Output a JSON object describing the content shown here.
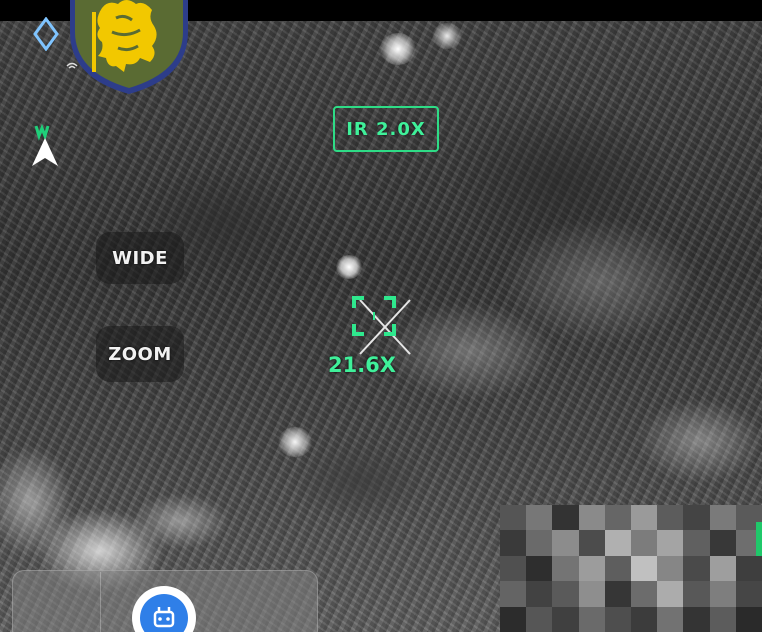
{
  "hud": {
    "camera_mode_label": "IR 2.0X",
    "wide_label": "WIDE",
    "zoom_label": "ZOOM",
    "target_zoom_label": "21.6X"
  },
  "icons": {
    "compass": "compass-diamond-icon",
    "emblem": "unit-emblem-lion-shield",
    "north": "north-arrow-icon",
    "controller": "remote-controller-icon"
  },
  "colors": {
    "hud_green": "#3ff09a",
    "hud_green_border": "#2edc86",
    "controller_blue": "#2f7fe8",
    "emblem_gold": "#f2c800",
    "emblem_green": "#5a6b33",
    "emblem_border": "#2d3d8a"
  }
}
